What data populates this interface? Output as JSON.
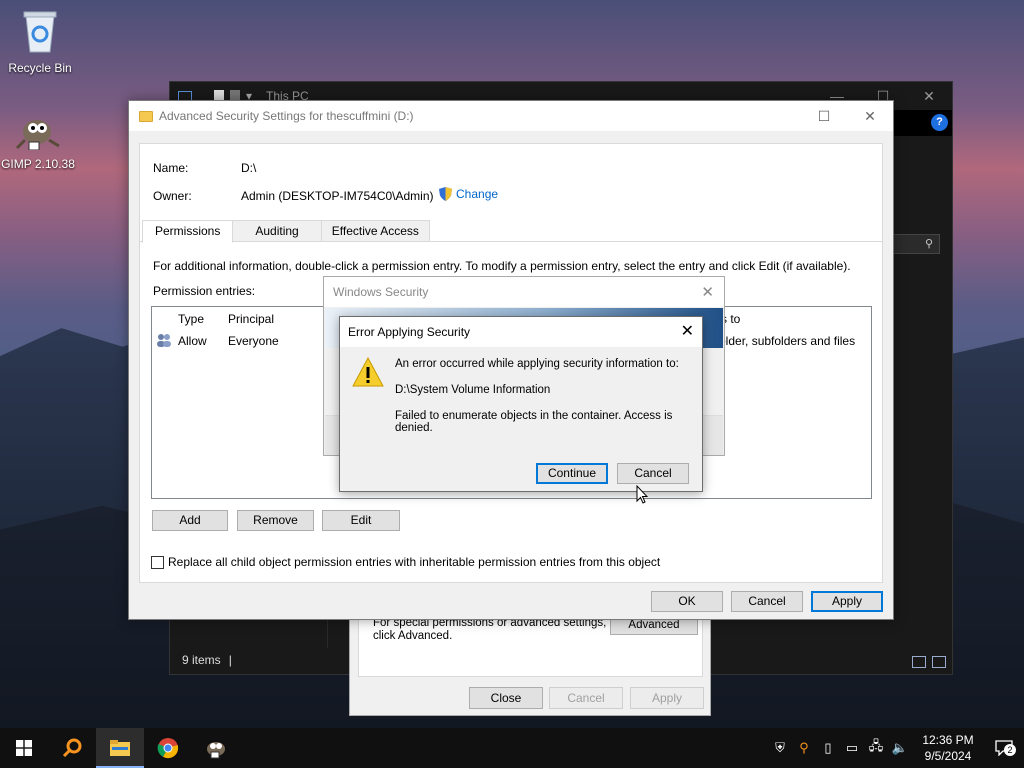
{
  "desktop": {
    "icons": [
      {
        "label": "Recycle Bin",
        "icon": "recycle-bin-icon"
      },
      {
        "label": "GIMP 2.10.38",
        "icon": "gimp-icon"
      }
    ]
  },
  "explorer": {
    "title": "This PC",
    "status": "9 items",
    "status_cursor": "|"
  },
  "properties": {
    "note_line1": "For special permissions or advanced settings,",
    "note_line2": "click Advanced.",
    "advanced_label": "Advanced",
    "close_label": "Close",
    "cancel_label": "Cancel",
    "apply_label": "Apply"
  },
  "advanced_security": {
    "title": "Advanced Security Settings for thescuffmini (D:)",
    "name_label": "Name:",
    "name_value": "D:\\",
    "owner_label": "Owner:",
    "owner_value": "Admin (DESKTOP-IM754C0\\Admin)",
    "change_label": "Change",
    "tabs": [
      "Permissions",
      "Auditing",
      "Effective Access"
    ],
    "info_text": "For additional information, double-click a permission entry. To modify a permission entry, select the entry and click Edit (if available).",
    "entries_label": "Permission entries:",
    "columns": [
      "Type",
      "Principal",
      "s to"
    ],
    "rows": [
      {
        "type": "Allow",
        "principal": "Everyone",
        "applies": "older, subfolders and files"
      }
    ],
    "add_label": "Add",
    "remove_label": "Remove",
    "edit_label": "Edit",
    "replace_label": "Replace all child object permission entries with inheritable permission entries from this object",
    "replace_checked": false,
    "ok_label": "OK",
    "cancel_label": "Cancel",
    "apply_label": "Apply"
  },
  "windows_security": {
    "title": "Windows Security"
  },
  "error_dialog": {
    "title": "Error Applying Security",
    "line1": "An error occurred while applying security information to:",
    "line2": "D:\\System Volume Information",
    "line3": "Failed to enumerate objects in the container. Access is denied.",
    "continue_label": "Continue",
    "cancel_label": "Cancel"
  },
  "taskbar": {
    "apps": [
      "start-icon",
      "search-icon",
      "file-explorer-icon",
      "chrome-icon",
      "gimp-icon"
    ],
    "time": "12:36 PM",
    "date": "9/5/2024",
    "notification_count": "2"
  },
  "colors": {
    "accent": "#0078d7",
    "link": "#0066cc",
    "taskbar": "#101010"
  }
}
